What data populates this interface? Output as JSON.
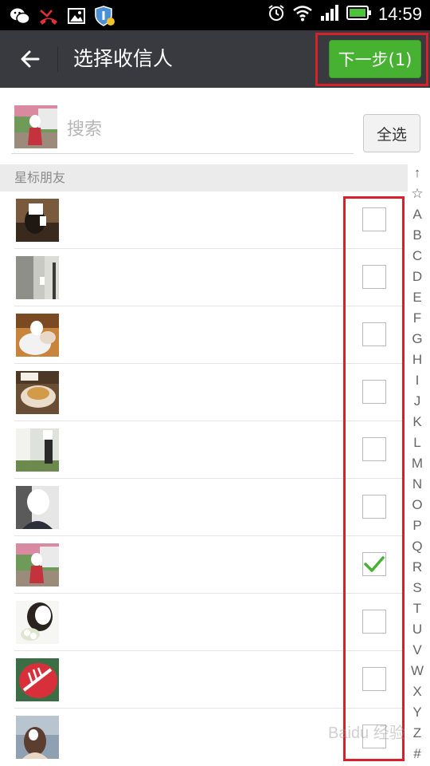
{
  "statusbar": {
    "time": "14:59"
  },
  "titlebar": {
    "title": "选择收信人",
    "next_label": "下一步(1)"
  },
  "search": {
    "placeholder": "搜索",
    "select_all_label": "全选"
  },
  "section": {
    "label": "星标朋友"
  },
  "contacts": [
    {
      "checked": false
    },
    {
      "checked": false
    },
    {
      "checked": false
    },
    {
      "checked": false
    },
    {
      "checked": false
    },
    {
      "checked": false
    },
    {
      "checked": true
    },
    {
      "checked": false
    },
    {
      "checked": false
    },
    {
      "checked": false
    }
  ],
  "index_letters": [
    "↑",
    "☆",
    "A",
    "B",
    "C",
    "D",
    "E",
    "F",
    "G",
    "H",
    "I",
    "J",
    "K",
    "L",
    "M",
    "N",
    "O",
    "P",
    "Q",
    "R",
    "S",
    "T",
    "U",
    "V",
    "W",
    "X",
    "Y",
    "Z",
    "#"
  ],
  "watermark": "Baidu 经验",
  "colors": {
    "titlebar": "#393a3f",
    "next_button": "#47b131",
    "highlight": "#d6202a",
    "check": "#47b131"
  }
}
